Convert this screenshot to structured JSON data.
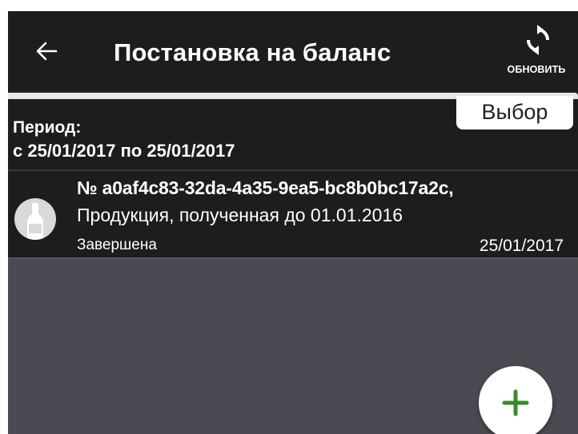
{
  "header": {
    "title": "Постановка на баланс",
    "refresh_label": "ОБНОВИТЬ",
    "back_icon": "arrow-left-icon",
    "refresh_icon": "refresh-icon"
  },
  "filter": {
    "select_label": "Выбор",
    "period_label": "Период:",
    "period_value": "с 25/01/2017 по 25/01/2017"
  },
  "documents": [
    {
      "icon": "bottle-icon",
      "title": "№ a0af4c83-32da-4a35-9ea5-bc8b0bc17a2c,",
      "subtitle": "Продукция, полученная до 01.01.2016",
      "status": "Завершена",
      "date": "25/01/2017"
    }
  ],
  "fab": {
    "icon": "plus-icon",
    "color": "#3a8a2a"
  },
  "colors": {
    "background": "#1d1d1d",
    "content_background": "#4a4a52",
    "text": "#ffffff"
  }
}
